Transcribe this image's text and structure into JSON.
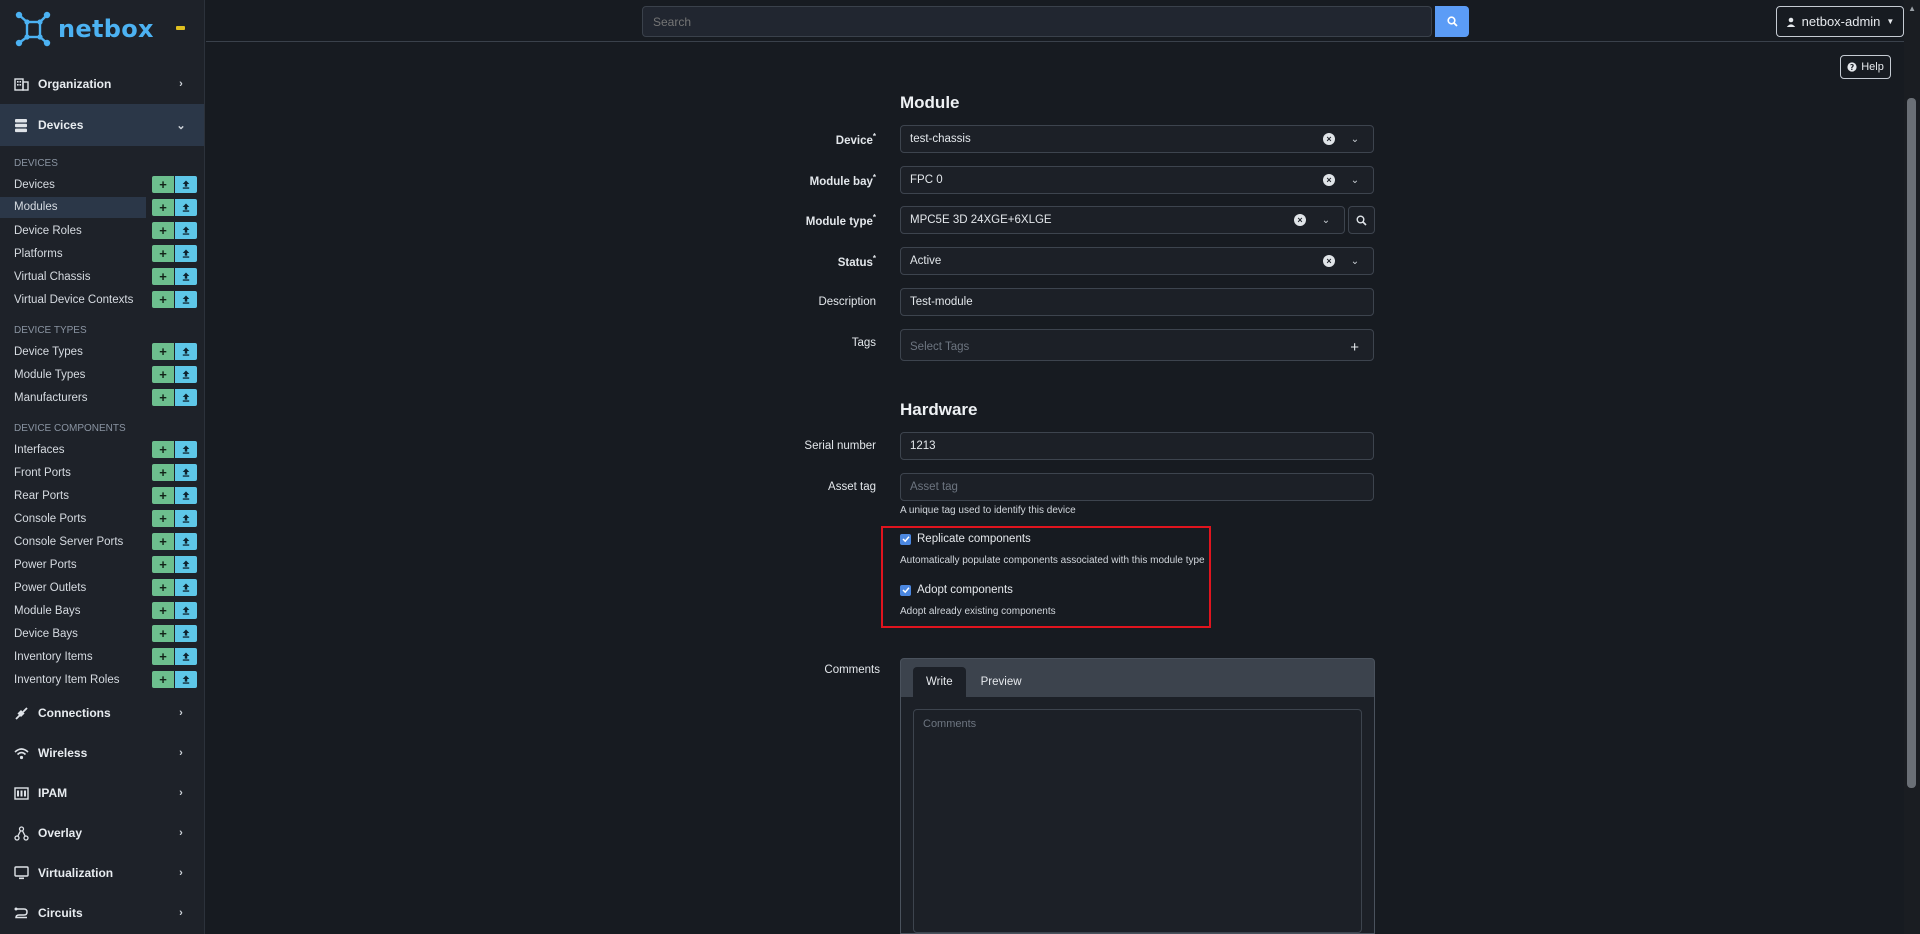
{
  "brand": {
    "name": "netbox"
  },
  "topbar": {
    "search_placeholder": "Search",
    "user_label": "netbox-admin"
  },
  "help_label": "Help",
  "sidebar": {
    "organization": "Organization",
    "devices": "Devices",
    "sections": {
      "devices": "DEVICES",
      "device_types": "DEVICE TYPES",
      "device_components": "DEVICE COMPONENTS"
    },
    "device_items": [
      "Devices",
      "Modules",
      "Device Roles",
      "Platforms",
      "Virtual Chassis",
      "Virtual Device Contexts"
    ],
    "type_items": [
      "Device Types",
      "Module Types",
      "Manufacturers"
    ],
    "component_items": [
      "Interfaces",
      "Front Ports",
      "Rear Ports",
      "Console Ports",
      "Console Server Ports",
      "Power Ports",
      "Power Outlets",
      "Module Bays",
      "Device Bays",
      "Inventory Items",
      "Inventory Item Roles"
    ],
    "bottom_menus": [
      "Connections",
      "Wireless",
      "IPAM",
      "Overlay",
      "Virtualization",
      "Circuits"
    ]
  },
  "module": {
    "title": "Module",
    "device_label": "Device",
    "device_value": "test-chassis",
    "module_bay_label": "Module bay",
    "module_bay_value": "FPC 0",
    "module_type_label": "Module type",
    "module_type_value": "MPC5E 3D 24XGE+6XLGE",
    "status_label": "Status",
    "status_value": "Active",
    "description_label": "Description",
    "description_value": "Test-module",
    "tags_label": "Tags",
    "tags_placeholder": "Select Tags",
    "required_mark": "*"
  },
  "hardware": {
    "title": "Hardware",
    "serial_label": "Serial number",
    "serial_value": "1213",
    "asset_label": "Asset tag",
    "asset_placeholder": "Asset tag",
    "asset_help": "A unique tag used to identify this device",
    "replicate_label": "Replicate components",
    "replicate_help": "Automatically populate components associated with this module type",
    "adopt_label": "Adopt components",
    "adopt_help": "Adopt already existing components"
  },
  "comments": {
    "label": "Comments",
    "tab_write": "Write",
    "tab_preview": "Preview",
    "placeholder": "Comments"
  },
  "colors": {
    "accent": "#5b9cf6",
    "add": "#6dbf8e",
    "import": "#5ec7e8",
    "highlight": "#e0141e"
  }
}
